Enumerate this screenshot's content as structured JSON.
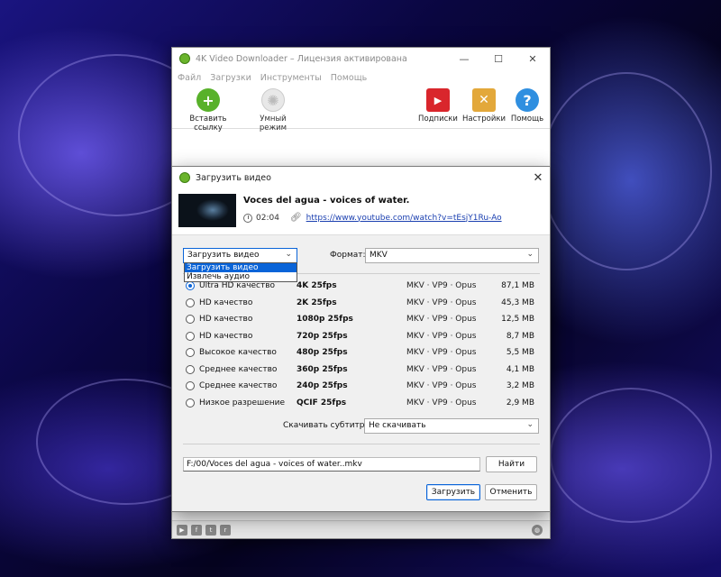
{
  "window": {
    "title": "4K Video Downloader – Лицензия активирована",
    "controls": {
      "minimize": "—",
      "maximize": "☐",
      "close": "✕"
    }
  },
  "menu": [
    "Файл",
    "Загрузки",
    "Инструменты",
    "Помощь"
  ],
  "toolbar": {
    "paste_link": "Вставить ссылку",
    "smart_mode": "Умный режим",
    "subscriptions": "Подписки",
    "settings": "Настройки",
    "help": "Помощь"
  },
  "dialog": {
    "title": "Загрузить видео",
    "close": "✕",
    "video": {
      "title": "Voces del agua - voices of water.",
      "duration": "02:04",
      "url": "https://www.youtube.com/watch?v=tEsjY1Ru-Ao"
    },
    "mode_select": {
      "value": "Загрузить видео",
      "options": [
        "Загрузить видео",
        "Извлечь аудио"
      ]
    },
    "format_label": "Формат:",
    "format_value": "MKV",
    "qualities": [
      {
        "name": "Ultra HD качество",
        "res": "4K 25fps",
        "fmt": "MKV · VP9 · Opus",
        "size": "87,1 MB",
        "selected": true
      },
      {
        "name": "HD качество",
        "res": "2K 25fps",
        "fmt": "MKV · VP9 · Opus",
        "size": "45,3 MB",
        "selected": false
      },
      {
        "name": "HD качество",
        "res": "1080p 25fps",
        "fmt": "MKV · VP9 · Opus",
        "size": "12,5 MB",
        "selected": false
      },
      {
        "name": "HD качество",
        "res": "720p 25fps",
        "fmt": "MKV · VP9 · Opus",
        "size": "8,7 MB",
        "selected": false
      },
      {
        "name": "Высокое качество",
        "res": "480p 25fps",
        "fmt": "MKV · VP9 · Opus",
        "size": "5,5 MB",
        "selected": false
      },
      {
        "name": "Среднее качество",
        "res": "360p 25fps",
        "fmt": "MKV · VP9 · Opus",
        "size": "4,1 MB",
        "selected": false
      },
      {
        "name": "Среднее качество",
        "res": "240p 25fps",
        "fmt": "MKV · VP9 · Opus",
        "size": "3,2 MB",
        "selected": false
      },
      {
        "name": "Низкое разрешение",
        "res": "QCIF 25fps",
        "fmt": "MKV · VP9 · Opus",
        "size": "2,9 MB",
        "selected": false
      }
    ],
    "subtitles_label": "Скачивать субтитры:",
    "subtitles_value": "Не скачивать",
    "path": "F:/00/Voces del agua - voices of water..mkv",
    "browse": "Найти",
    "download": "Загрузить",
    "cancel": "Отменить"
  },
  "statusbar": {
    "icons": [
      "youtube-icon",
      "facebook-icon",
      "twitter-icon",
      "reddit-icon",
      "globe-icon"
    ]
  },
  "colors": {
    "accent": "#0a64d8",
    "brand_green": "#6ab42c",
    "link": "#1a3fb0"
  }
}
